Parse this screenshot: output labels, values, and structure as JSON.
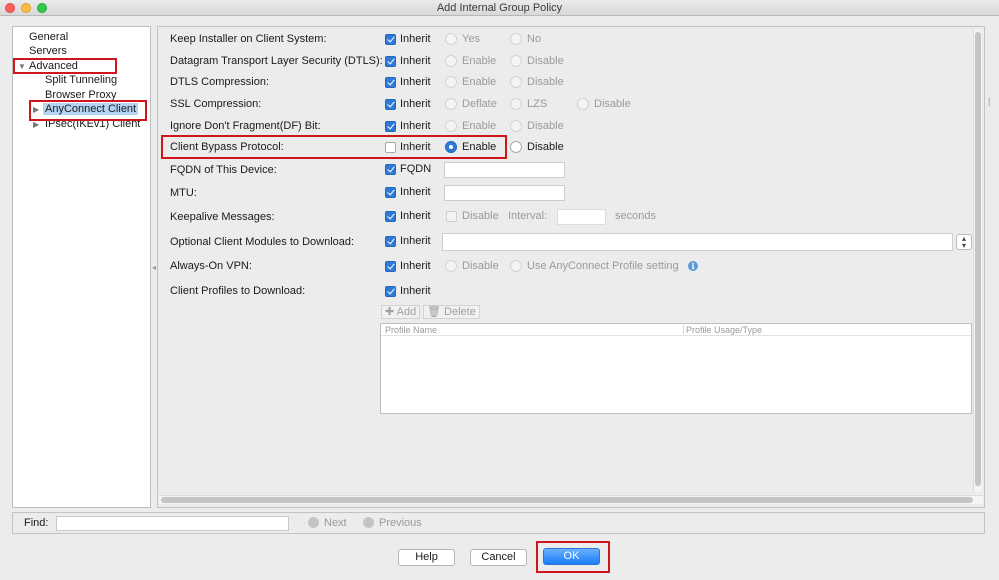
{
  "window": {
    "title": "Add Internal Group Policy"
  },
  "nav": {
    "items": [
      {
        "label": "General"
      },
      {
        "label": "Servers"
      },
      {
        "label": "Advanced"
      },
      {
        "label": "Split Tunneling"
      },
      {
        "label": "Browser Proxy"
      },
      {
        "label": "AnyConnect Client"
      },
      {
        "label": "IPsec(IKEv1) Client"
      }
    ]
  },
  "form": {
    "keep_installer": {
      "label": "Keep Installer on Client System:",
      "inherit": "Inherit",
      "opt1": "Yes",
      "opt2": "No"
    },
    "dtls": {
      "label": "Datagram Transport Layer Security (DTLS):",
      "inherit": "Inherit",
      "opt1": "Enable",
      "opt2": "Disable"
    },
    "dtls_compression": {
      "label": "DTLS Compression:",
      "inherit": "Inherit",
      "opt1": "Enable",
      "opt2": "Disable"
    },
    "ssl_compression": {
      "label": "SSL Compression:",
      "inherit": "Inherit",
      "opt1": "Deflate",
      "opt2": "LZS",
      "opt3": "Disable"
    },
    "ignore_df": {
      "label": "Ignore Don't Fragment(DF) Bit:",
      "inherit": "Inherit",
      "opt1": "Enable",
      "opt2": "Disable"
    },
    "client_bypass": {
      "label": "Client Bypass Protocol:",
      "inherit": "Inherit",
      "opt1": "Enable",
      "opt2": "Disable",
      "selected": "Enable"
    },
    "fqdn": {
      "label": "FQDN of This Device:",
      "check": "FQDN",
      "value": ""
    },
    "mtu": {
      "label": "MTU:",
      "inherit": "Inherit",
      "value": ""
    },
    "keepalive": {
      "label": "Keepalive Messages:",
      "inherit": "Inherit",
      "disable": "Disable",
      "interval_label": "Interval:",
      "interval_value": "",
      "units": "seconds"
    },
    "optional_modules": {
      "label": "Optional Client Modules to Download:",
      "inherit": "Inherit",
      "value": ""
    },
    "always_on": {
      "label": "Always-On VPN:",
      "inherit": "Inherit",
      "opt1": "Disable",
      "opt2": "Use AnyConnect Profile setting"
    },
    "client_profiles": {
      "label": "Client Profiles to Download:",
      "inherit": "Inherit",
      "add": "Add",
      "delete": "Delete"
    },
    "profile_table": {
      "columns": [
        "Profile Name",
        "Profile Usage/Type"
      ],
      "rows": []
    }
  },
  "find": {
    "label": "Find:",
    "value": "",
    "next": "Next",
    "previous": "Previous"
  },
  "buttons": {
    "help": "Help",
    "cancel": "Cancel",
    "ok": "OK"
  },
  "colors": {
    "highlight_red": "#d0151c",
    "accent_blue": "#2f7ad9",
    "selection": "#b5d4f4"
  }
}
